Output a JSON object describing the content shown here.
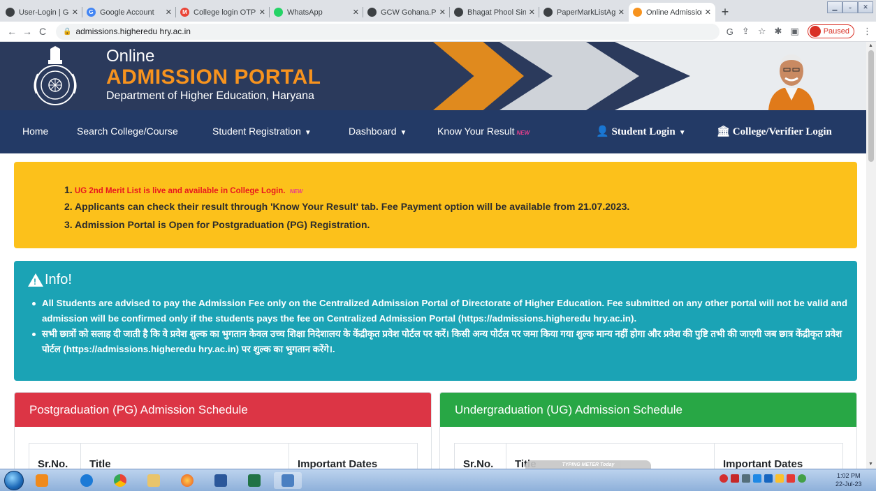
{
  "browser": {
    "tabs": [
      {
        "title": "User-Login | Govern",
        "fav_color": "#3c4043"
      },
      {
        "title": "Google Account",
        "fav_color": "#4285f4"
      },
      {
        "title": "College login OTP -",
        "fav_color": "#ea4335"
      },
      {
        "title": "WhatsApp",
        "fav_color": "#25d366"
      },
      {
        "title": "GCW Gohana.PDF",
        "fav_color": "#3c4043"
      },
      {
        "title": "Bhagat Phool Singh",
        "fav_color": "#3c4043"
      },
      {
        "title": "PaperMarkListAgain",
        "fav_color": "#3c4043"
      },
      {
        "title": "Online Admission",
        "fav_color": "#f7931e",
        "active": true
      }
    ],
    "new_tab_label": "+",
    "url": "admissions.higheredu hry.ac.in",
    "profile_status": "Paused"
  },
  "banner": {
    "line1": "Online",
    "line2": "ADMISSION PORTAL",
    "line3": "Department of Higher Education, Haryana"
  },
  "nav": {
    "home": "Home",
    "search": "Search College/Course",
    "registration": "Student Registration",
    "dashboard": "Dashboard",
    "result": "Know Your Result",
    "new_badge": "NEW",
    "student_login": "Student Login",
    "college_login": "College/Verifier Login"
  },
  "notices": {
    "item1_num": "1.",
    "item1_text": "UG 2nd Merit List is live and available in College Login.",
    "item1_badge": "NEW",
    "item2": "2. Applicants can check their result through 'Know Your Result' tab. Fee Payment option will be available from 21.07.2023.",
    "item3": "3. Admission Portal is Open for Postgraduation (PG) Registration."
  },
  "info": {
    "heading": "Info!",
    "en": "All Students are advised to pay the Admission Fee only on the Centralized Admission Portal of Directorate of Higher Education. Fee submitted on any other portal will not be valid and admission will be confirmed only if the students pays the fee on Centralized Admission Portal (https://admissions.higheredu hry.ac.in).",
    "hi": "सभी छात्रों को सलाह दी जाती है कि वे प्रवेश शुल्क का भुगतान केवल उच्च शिक्षा निदेशालय के केंद्रीकृत प्रवेश पोर्टल पर करें। किसी अन्य पोर्टल पर जमा किया गया शुल्क मान्य नहीं होगा और प्रवेश की पुष्टि तभी की जाएगी जब छात्र केंद्रीकृत प्रवेश पोर्टल (https://admissions.higheredu hry.ac.in) पर शुल्क का भुगतान करेंगे।."
  },
  "pg_card": {
    "header": "Postgraduation (PG) Admission Schedule",
    "col1": "Sr.No.",
    "col2": "Title",
    "col3": "Important Dates"
  },
  "ug_card": {
    "header": "Undergraduation (UG) Admission Schedule",
    "col1": "Sr.No.",
    "col2": "Title",
    "col3": "Important Dates"
  },
  "overlay": {
    "typing_meter": "TYPING METER Today"
  },
  "taskbar": {
    "time": "1:02 PM",
    "date": "22-Jul-23"
  },
  "colors": {
    "banner_bg": "#2b3a5c",
    "navbar_bg": "#233a66",
    "notice_bg": "#fcc11b",
    "info_bg": "#1ba3b5",
    "pg_header": "#dc3545",
    "ug_header": "#28a745",
    "accent_orange": "#f7931e"
  }
}
